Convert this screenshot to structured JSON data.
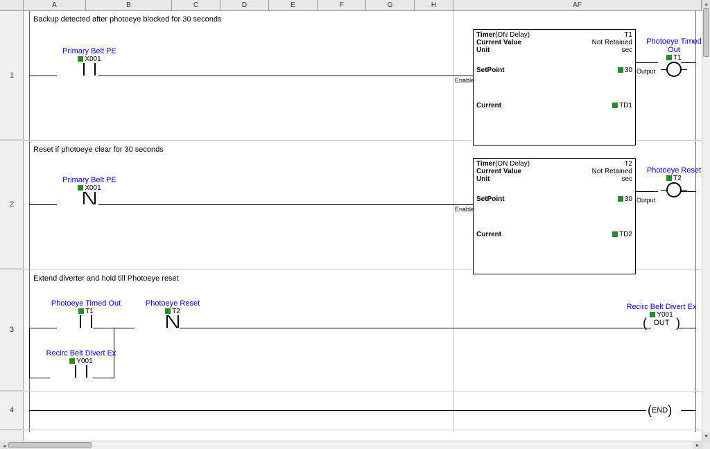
{
  "columns": [
    "A",
    "B",
    "C",
    "D",
    "E",
    "F",
    "G",
    "H",
    "AF"
  ],
  "rows": [
    "1",
    "2",
    "3",
    "4"
  ],
  "rung1": {
    "comment": "Backup detected after photoeye blocked for 30 seconds",
    "contact": {
      "label": "Primary Belt PE",
      "addr": "X001"
    },
    "timer": {
      "title": "Timer",
      "type": "(ON Delay)",
      "id": "T1",
      "cvLabel": "Current Value",
      "cvVal": "Not Retained",
      "unitLabel": "Unit",
      "unitVal": "sec",
      "spLabel": "SetPoint",
      "spVal": "30",
      "curLabel": "Current",
      "curVal": "TD1",
      "enable": "Enable",
      "output": "Output"
    },
    "coil": {
      "label": "Photoeye Timed Out",
      "addr": "T1"
    }
  },
  "rung2": {
    "comment": "Reset if photoeye clear for 30 seconds",
    "contact": {
      "label": "Primary Belt PE",
      "addr": "X001"
    },
    "timer": {
      "title": "Timer",
      "type": "(ON Delay)",
      "id": "T2",
      "cvLabel": "Current Value",
      "cvVal": "Not Retained",
      "unitLabel": "Unit",
      "unitVal": "sec",
      "spLabel": "SetPoint",
      "spVal": "30",
      "curLabel": "Current",
      "curVal": "TD2",
      "enable": "Enable",
      "output": "Output"
    },
    "coil": {
      "label": "Photoeye Reset",
      "addr": "T2"
    }
  },
  "rung3": {
    "comment": "Extend diverter and hold till Photoeye reset",
    "contactA": {
      "label": "Photoeye Timed Out",
      "addr": "T1"
    },
    "contactB": {
      "label": "Photoeye Reset",
      "addr": "T2"
    },
    "branch": {
      "label": "Recirc Belt Divert Ex",
      "addr": "Y001"
    },
    "coil": {
      "label": "Recirc Belt Divert Ex",
      "addr": "Y001",
      "txt": "OUT"
    }
  },
  "rung4": {
    "end": "END"
  }
}
